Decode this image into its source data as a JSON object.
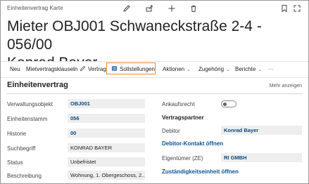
{
  "window": {
    "caption": "Einheitenvertrag Karte"
  },
  "title": {
    "line1": "Mieter OBJ001 Schwaneckstraße 2-4 - 056/00",
    "line2": "Konrad Bayer"
  },
  "actions": {
    "neu": "Neu",
    "mietvertragsklauseln": "Mietvertragsklauseln",
    "vertrag": "Vertrag",
    "sollstellungen": "Sollstellungen",
    "aktionen": "Aktionen",
    "zugehoerig": "Zugehörig",
    "berichte": "Berichte",
    "more": "···"
  },
  "section": {
    "title": "Einheitenvertrag",
    "more_link": "Mehr anzeigen"
  },
  "fields_left": {
    "verwaltungsobjekt": {
      "label": "Verwaltungsobjekt",
      "value": "OBJ001"
    },
    "einheitenstamm": {
      "label": "Einheitenstamm",
      "value": "056"
    },
    "historie": {
      "label": "Historie",
      "value": "00"
    },
    "suchbegriff": {
      "label": "Suchbegriff",
      "value": "KONRAD BAYER"
    },
    "status": {
      "label": "Status",
      "value": "Unbefristet"
    },
    "beschreibung": {
      "label": "Beschreibung",
      "value": "Wohnung, 1. Obergeschoss, 2..."
    }
  },
  "fields_right": {
    "ankaufsrecht": {
      "label": "Ankaufsrecht",
      "checked": false
    },
    "vertragspartner_heading": "Vertragspartner",
    "debitor": {
      "label": "Debitor",
      "value": "Konrad Bayer"
    },
    "debitor_kontakt_link": "Debitor-Kontakt öffnen",
    "eigentuemer": {
      "label": "Eigentümer (ZE)",
      "value": "RI GMBH"
    },
    "zustaendigkeit_link": "Zuständigkeitseinheit öffnen"
  },
  "colors": {
    "accent_link": "#0b5394",
    "highlight_border": "#f08a24",
    "field_bg": "#eeeeee"
  }
}
